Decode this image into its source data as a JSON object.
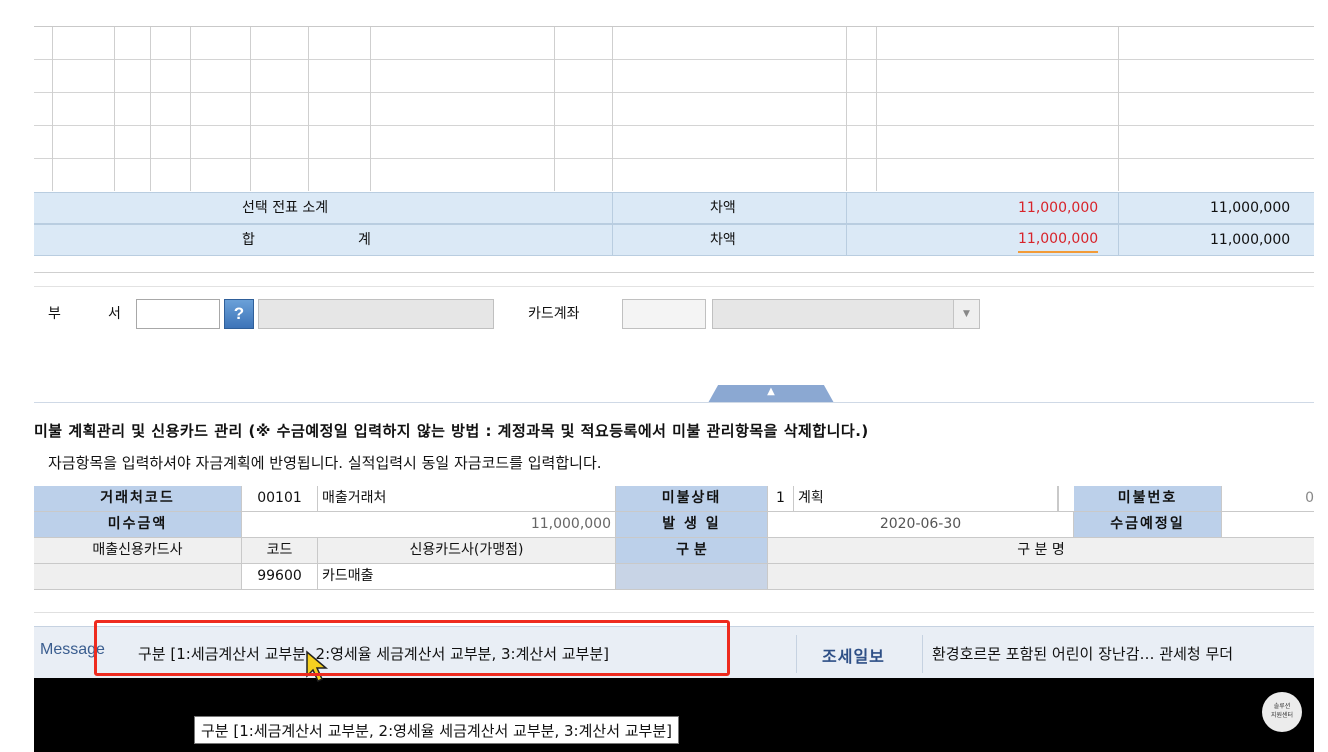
{
  "summary": {
    "selected_subtotal_label": "선택 전표 소계",
    "total_label_left": "합",
    "total_label_right": "계",
    "debit_label_1": "차액",
    "debit_label_2": "차액",
    "subtotal_amount_red": "11,000,000",
    "subtotal_amount": "11,000,000",
    "total_amount_red": "11,000,000",
    "total_amount": "11,000,000"
  },
  "form": {
    "department_label_1": "부",
    "department_label_2": "서",
    "help_icon_text": "?",
    "card_account_label": "카드계좌",
    "collapse_arrow": "▲",
    "select_arrow": "▼"
  },
  "notice": {
    "line1": "미불 계획관리 및 신용카드 관리      (※ 수금예정일  입력하지  않는  방법  :  계정과목 및 적요등록에서 미불 관리항목을 삭제합니다.)",
    "line2": "자금항목을 입력하셔야 자금계획에 반영됩니다. 실적입력시 동일 자금코드를 입력합니다."
  },
  "detail": {
    "client_code_label": "거래처코드",
    "client_code": "00101",
    "client_name": "매출거래처",
    "unpaid_status_label": "미불상태",
    "unpaid_status_code": "1",
    "unpaid_status_name": "계획",
    "unpaid_number_label": "미불번호",
    "unpaid_number_partial": "0",
    "receivable_label": "미수금액",
    "receivable_amount": "11,000,000",
    "occurrence_date_label": "발 생 일",
    "occurrence_date": "2020-06-30",
    "expected_collection_label": "수금예정일",
    "card_company_label": "매출신용카드사",
    "code_label": "코드",
    "card_merchant_label": "신용카드사(가맹점)",
    "category_label": "구    분",
    "category_name_label": "구    분    명",
    "card_code": "99600",
    "card_name": "카드매출"
  },
  "message_bar": {
    "label": "Message",
    "text": "구분 [1:세금계산서 교부분, 2:영세율 세금계산서 교부분, 3:계산서 교부분]",
    "news_label": "조세일보",
    "news_text": "환경호르몬 포함된 어린이 장난감… 관세청 무더"
  },
  "tooltip": {
    "text": "구분 [1:세금계산서 교부분, 2:영세율 세금계산서 교부분, 3:계산서 교부분]"
  },
  "logo": {
    "line1": "솔루션",
    "line2": "지원센터"
  },
  "colors": {
    "header_blue": "#bcd0ea",
    "summary_blue": "#dbe9f6",
    "highlight_red": "#ee2b1f",
    "amount_red": "#d8232a"
  }
}
